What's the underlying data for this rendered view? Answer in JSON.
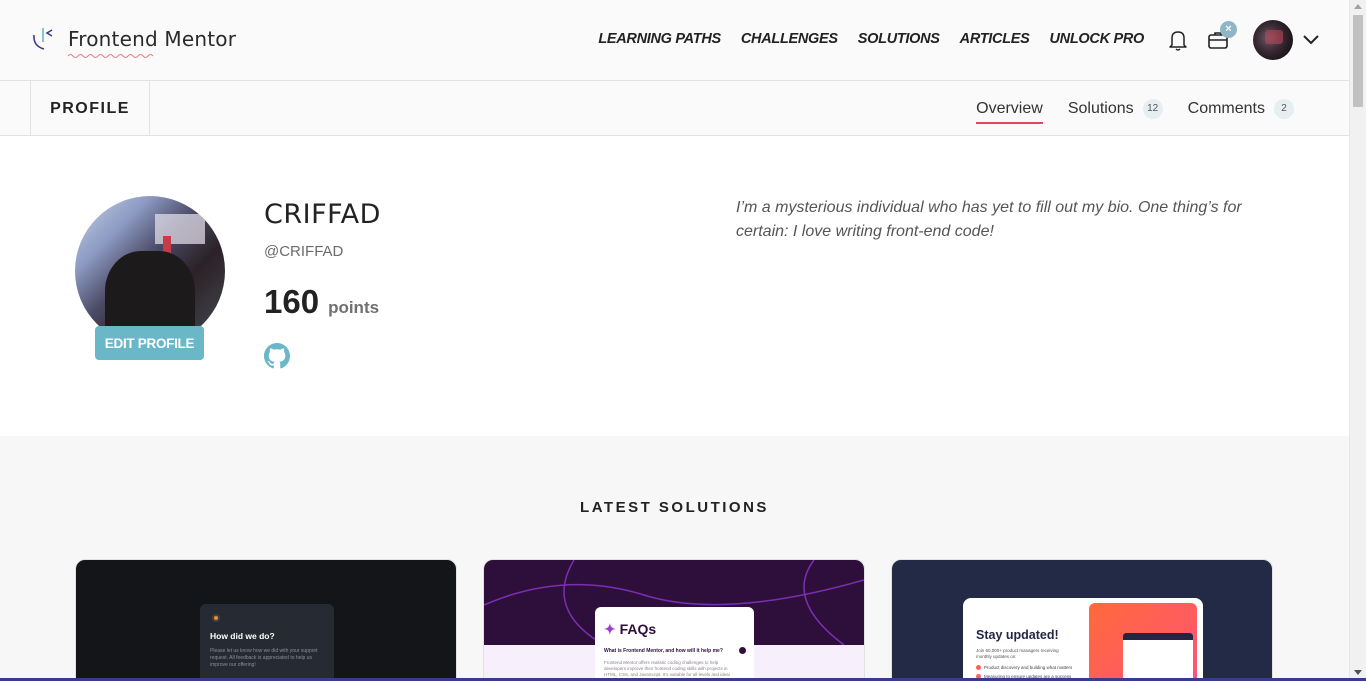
{
  "header": {
    "logo_text": "Frontend Mentor",
    "nav": [
      "LEARNING PATHS",
      "CHALLENGES",
      "SOLUTIONS",
      "ARTICLES",
      "UNLOCK PRO"
    ],
    "notification_badge": "×",
    "icons": [
      "bell-icon",
      "briefcase-icon",
      "chevron-down-icon"
    ],
    "accent_color": "#e0475c"
  },
  "subnav": {
    "profile_label": "PROFILE",
    "tabs": [
      {
        "label": "Overview",
        "count": "",
        "active": true
      },
      {
        "label": "Solutions",
        "count": "12",
        "active": false
      },
      {
        "label": "Comments",
        "count": "2",
        "active": false
      }
    ]
  },
  "profile": {
    "name": "CRIFFAD",
    "handle": "@CRIFFAD",
    "points": "160",
    "points_label": "points",
    "edit_button": "EDIT PROFILE",
    "bio": "I’m a mysterious individual who has yet to fill out my bio. One thing’s for certain: I love writing front-end code!",
    "links": [
      "github-icon"
    ]
  },
  "latest": {
    "title": "LATEST SOLUTIONS",
    "cards": [
      {
        "heading": "How did we do?",
        "text": "Please let us know how we did with your support request. All feedback is appreciated to help us improve our offering!"
      },
      {
        "heading": "FAQs",
        "star": "✦",
        "question": "What is Frontend Mentor, and how will it help me?",
        "text": "Frontend Mentor offers realistic coding challenges to help developers improve their frontend coding skills with projects in HTML, CSS, and JavaScript. It's suitable for all levels and ideal for"
      },
      {
        "heading": "Stay updated!",
        "text": "Join 60,000+ product managers receiving monthly updates on:",
        "items": [
          "Product discovery and building what matters",
          "Measuring to ensure updates are a success"
        ]
      }
    ]
  }
}
